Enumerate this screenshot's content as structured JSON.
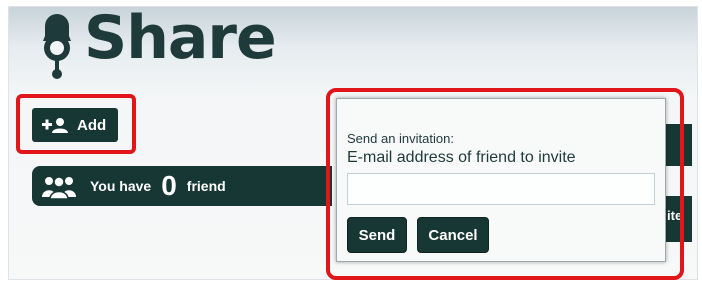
{
  "header": {
    "title": "Share",
    "icon": "bell-icon"
  },
  "add_button": {
    "label": "Add",
    "icon": "add-user-icon"
  },
  "friends_bar": {
    "icon": "group-icon",
    "prefix": "You have",
    "count": "0",
    "suffix": "friend"
  },
  "dialog": {
    "prompt": "Send an invitation:",
    "field_label": "E-mail address of friend to invite",
    "email_value": "",
    "send_label": "Send",
    "cancel_label": "Cancel"
  },
  "background": {
    "partial_text": "ite"
  },
  "colors": {
    "primary": "#173734",
    "highlight": "#e0161b",
    "title": "#1f3a3a"
  }
}
